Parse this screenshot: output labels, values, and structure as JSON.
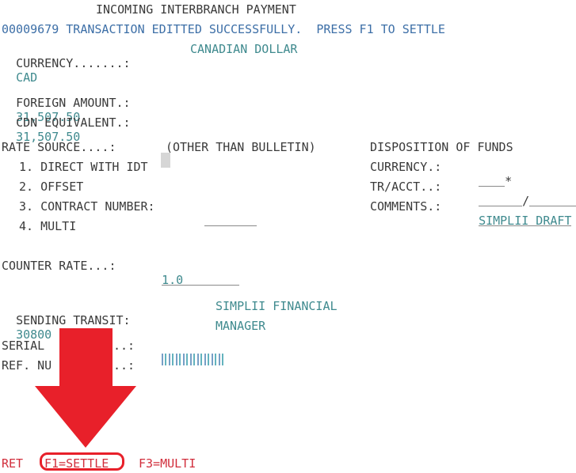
{
  "title": "INCOMING INTERBRANCH PAYMENT",
  "status_message": "00009679 TRANSACTION EDITTED SUCCESSFULLY.  PRESS F1 TO SETTLE",
  "currency": {
    "label": "CURRENCY.......:",
    "code": "CAD",
    "name": "CANADIAN DOLLAR"
  },
  "foreign_amount": {
    "label": "FOREIGN AMOUNT.:",
    "value": "31,507.50"
  },
  "cdn_equivalent": {
    "label": "CDN EQUIVALENT.:",
    "value": "31,507.50"
  },
  "rate_source": {
    "label": "RATE SOURCE....:",
    "value": "",
    "note": "(OTHER THAN BULLETIN)",
    "options": [
      "1. DIRECT WITH IDT",
      "2. OFFSET",
      "3. CONTRACT NUMBER:",
      "4. MULTI"
    ],
    "contract_number": ""
  },
  "disposition": {
    "heading": "DISPOSITION OF FUNDS",
    "currency_label": "CURRENCY.:",
    "currency_value": "",
    "currency_marker": "*",
    "tr_acct_label": "TR/ACCT..:",
    "tr_value": "",
    "tr_separator": "/",
    "acct_value": "",
    "comments_label": "COMMENTS.:",
    "comments_value": "SIMPLII DRAFT"
  },
  "counter_rate": {
    "label": "COUNTER RATE...:",
    "value": "1.0"
  },
  "sending_transit": {
    "label": "SENDING TRANSIT:",
    "value": "30800",
    "name_line1": "SIMPLII FINANCIAL",
    "name_line2": "MANAGER"
  },
  "serial": {
    "label_start": "SERIAL",
    "label_end": "..:"
  },
  "ref_number": {
    "label_start": "REF. NU",
    "label_end": "..:"
  },
  "function_keys": {
    "ret": "RET",
    "f1": "F1=SETTLE",
    "f3": "F3=MULTI"
  },
  "colors": {
    "label": "#3a3a3a",
    "value": "#3f8a8e",
    "message": "#3d6fa7",
    "function_keys": "#d12d3b",
    "annotation": "#e8202a"
  }
}
